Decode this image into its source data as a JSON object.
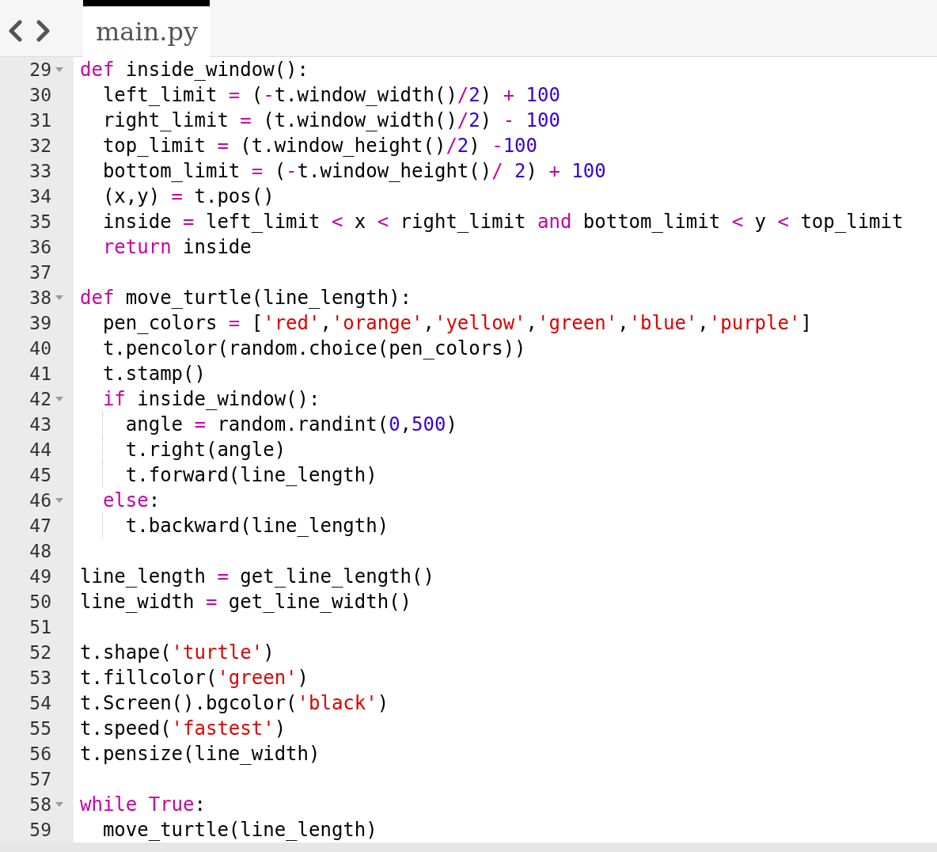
{
  "tabs": [
    {
      "label": "main.py",
      "selected": true
    }
  ],
  "lines": [
    {
      "number": "29",
      "foldable": true,
      "tokens": [
        {
          "kind": "keyword",
          "text": "def"
        },
        {
          "kind": "plain",
          "text": " inside_window():"
        }
      ]
    },
    {
      "number": "30",
      "foldable": false,
      "tokens": [
        {
          "kind": "plain",
          "text": "  left_limit "
        },
        {
          "kind": "operator",
          "text": "="
        },
        {
          "kind": "plain",
          "text": " ("
        },
        {
          "kind": "operator",
          "text": "-"
        },
        {
          "kind": "plain",
          "text": "t.window_width()"
        },
        {
          "kind": "operator",
          "text": "/"
        },
        {
          "kind": "number",
          "text": "2"
        },
        {
          "kind": "plain",
          "text": ") "
        },
        {
          "kind": "operator",
          "text": "+"
        },
        {
          "kind": "number",
          "text": " 100"
        }
      ]
    },
    {
      "number": "31",
      "foldable": false,
      "tokens": [
        {
          "kind": "plain",
          "text": "  right_limit "
        },
        {
          "kind": "operator",
          "text": "="
        },
        {
          "kind": "plain",
          "text": " (t.window_width()"
        },
        {
          "kind": "operator",
          "text": "/"
        },
        {
          "kind": "number",
          "text": "2"
        },
        {
          "kind": "plain",
          "text": ") "
        },
        {
          "kind": "operator",
          "text": "-"
        },
        {
          "kind": "number",
          "text": " 100"
        }
      ]
    },
    {
      "number": "32",
      "foldable": false,
      "tokens": [
        {
          "kind": "plain",
          "text": "  top_limit "
        },
        {
          "kind": "operator",
          "text": "="
        },
        {
          "kind": "plain",
          "text": " (t.window_height()"
        },
        {
          "kind": "operator",
          "text": "/"
        },
        {
          "kind": "number",
          "text": "2"
        },
        {
          "kind": "plain",
          "text": ") "
        },
        {
          "kind": "operator",
          "text": "-"
        },
        {
          "kind": "number",
          "text": "100"
        }
      ]
    },
    {
      "number": "33",
      "foldable": false,
      "tokens": [
        {
          "kind": "plain",
          "text": "  bottom_limit "
        },
        {
          "kind": "operator",
          "text": "="
        },
        {
          "kind": "plain",
          "text": " ("
        },
        {
          "kind": "operator",
          "text": "-"
        },
        {
          "kind": "plain",
          "text": "t.window_height()"
        },
        {
          "kind": "operator",
          "text": "/"
        },
        {
          "kind": "number",
          "text": " 2"
        },
        {
          "kind": "plain",
          "text": ") "
        },
        {
          "kind": "operator",
          "text": "+"
        },
        {
          "kind": "number",
          "text": " 100"
        }
      ]
    },
    {
      "number": "34",
      "foldable": false,
      "tokens": [
        {
          "kind": "plain",
          "text": "  (x,y) "
        },
        {
          "kind": "operator",
          "text": "="
        },
        {
          "kind": "plain",
          "text": " t.pos()"
        }
      ]
    },
    {
      "number": "35",
      "foldable": false,
      "tokens": [
        {
          "kind": "plain",
          "text": "  inside "
        },
        {
          "kind": "operator",
          "text": "="
        },
        {
          "kind": "plain",
          "text": " left_limit "
        },
        {
          "kind": "operator",
          "text": "<"
        },
        {
          "kind": "plain",
          "text": " x "
        },
        {
          "kind": "operator",
          "text": "<"
        },
        {
          "kind": "plain",
          "text": " right_limit "
        },
        {
          "kind": "keyword",
          "text": "and"
        },
        {
          "kind": "plain",
          "text": " bottom_limit "
        },
        {
          "kind": "operator",
          "text": "<"
        },
        {
          "kind": "plain",
          "text": " y "
        },
        {
          "kind": "operator",
          "text": "<"
        },
        {
          "kind": "plain",
          "text": " top_limit"
        }
      ]
    },
    {
      "number": "36",
      "foldable": false,
      "tokens": [
        {
          "kind": "keyword",
          "text": "  return"
        },
        {
          "kind": "plain",
          "text": " inside"
        }
      ]
    },
    {
      "number": "37",
      "foldable": false
    },
    {
      "number": "38",
      "foldable": true,
      "tokens": [
        {
          "kind": "keyword",
          "text": "def"
        },
        {
          "kind": "plain",
          "text": " move_turtle(line_length):"
        }
      ]
    },
    {
      "number": "39",
      "foldable": false,
      "tokens": [
        {
          "kind": "plain",
          "text": "  pen_colors "
        },
        {
          "kind": "operator",
          "text": "="
        },
        {
          "kind": "plain",
          "text": " ["
        },
        {
          "kind": "string",
          "text": "'red'"
        },
        {
          "kind": "plain",
          "text": ","
        },
        {
          "kind": "string",
          "text": "'orange'"
        },
        {
          "kind": "plain",
          "text": ","
        },
        {
          "kind": "string",
          "text": "'yellow'"
        },
        {
          "kind": "plain",
          "text": ","
        },
        {
          "kind": "string",
          "text": "'green'"
        },
        {
          "kind": "plain",
          "text": ","
        },
        {
          "kind": "string",
          "text": "'blue'"
        },
        {
          "kind": "plain",
          "text": ","
        },
        {
          "kind": "string",
          "text": "'purple'"
        },
        {
          "kind": "plain",
          "text": "]"
        }
      ]
    },
    {
      "number": "40",
      "foldable": false,
      "tokens": [
        {
          "kind": "plain",
          "text": "  t.pencolor(random.choice(pen_colors))"
        }
      ]
    },
    {
      "number": "41",
      "foldable": false,
      "tokens": [
        {
          "kind": "plain",
          "text": "  t.stamp()"
        }
      ]
    },
    {
      "number": "42",
      "foldable": true,
      "tokens": [
        {
          "kind": "keyword",
          "text": "  if"
        },
        {
          "kind": "plain",
          "text": " inside_window():"
        }
      ]
    },
    {
      "number": "43",
      "foldable": false,
      "tokens": [
        {
          "kind": "plain",
          "text": "    angle "
        },
        {
          "kind": "operator",
          "text": "="
        },
        {
          "kind": "plain",
          "text": " random.randint("
        },
        {
          "kind": "number",
          "text": "0"
        },
        {
          "kind": "plain",
          "text": ","
        },
        {
          "kind": "number",
          "text": "500"
        },
        {
          "kind": "plain",
          "text": ")"
        }
      ]
    },
    {
      "number": "44",
      "foldable": false,
      "tokens": [
        {
          "kind": "plain",
          "text": "    t.right(angle)"
        }
      ]
    },
    {
      "number": "45",
      "foldable": false,
      "tokens": [
        {
          "kind": "plain",
          "text": "    t.forward(line_length)"
        }
      ]
    },
    {
      "number": "46",
      "foldable": true,
      "tokens": [
        {
          "kind": "keyword",
          "text": "  else"
        },
        {
          "kind": "plain",
          "text": ":"
        }
      ]
    },
    {
      "number": "47",
      "foldable": false,
      "tokens": [
        {
          "kind": "plain",
          "text": "    t.backward(line_length)"
        }
      ]
    },
    {
      "number": "48",
      "foldable": false
    },
    {
      "number": "49",
      "foldable": false,
      "tokens": [
        {
          "kind": "plain",
          "text": "line_length "
        },
        {
          "kind": "operator",
          "text": "="
        },
        {
          "kind": "plain",
          "text": " get_line_length()"
        }
      ]
    },
    {
      "number": "50",
      "foldable": false,
      "tokens": [
        {
          "kind": "plain",
          "text": "line_width "
        },
        {
          "kind": "operator",
          "text": "="
        },
        {
          "kind": "plain",
          "text": " get_line_width()"
        }
      ]
    },
    {
      "number": "51",
      "foldable": false
    },
    {
      "number": "52",
      "foldable": false,
      "tokens": [
        {
          "kind": "plain",
          "text": "t.shape("
        },
        {
          "kind": "string",
          "text": "'turtle'"
        },
        {
          "kind": "plain",
          "text": ")"
        }
      ]
    },
    {
      "number": "53",
      "foldable": false,
      "tokens": [
        {
          "kind": "plain",
          "text": "t.fillcolor("
        },
        {
          "kind": "string",
          "text": "'green'"
        },
        {
          "kind": "plain",
          "text": ")"
        }
      ]
    },
    {
      "number": "54",
      "foldable": false,
      "tokens": [
        {
          "kind": "plain",
          "text": "t.Screen().bgcolor("
        },
        {
          "kind": "string",
          "text": "'black'"
        },
        {
          "kind": "plain",
          "text": ")"
        }
      ]
    },
    {
      "number": "55",
      "foldable": false,
      "tokens": [
        {
          "kind": "plain",
          "text": "t.speed("
        },
        {
          "kind": "string",
          "text": "'fastest'"
        },
        {
          "kind": "plain",
          "text": ")"
        }
      ]
    },
    {
      "number": "56",
      "foldable": false,
      "tokens": [
        {
          "kind": "plain",
          "text": "t.pensize(line_width)"
        }
      ]
    },
    {
      "number": "57",
      "foldable": false
    },
    {
      "number": "58",
      "foldable": true,
      "tokens": [
        {
          "kind": "keyword",
          "text": "while"
        },
        {
          "kind": "keyword",
          "text": " True"
        },
        {
          "kind": "plain",
          "text": ":"
        }
      ]
    },
    {
      "number": "59",
      "foldable": false,
      "tokens": [
        {
          "kind": "plain",
          "text": "  move_turtle(line_length)"
        }
      ]
    }
  ]
}
